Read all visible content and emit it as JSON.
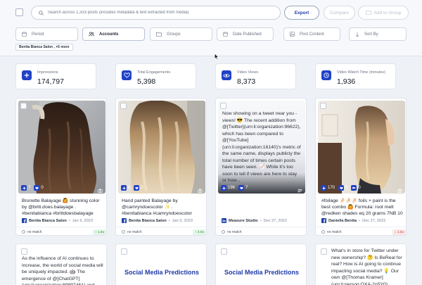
{
  "search": {
    "placeholder": "Search across 1,333 posts (includes metadata & text extracted from media)"
  },
  "actions": {
    "export": "Export",
    "compare": "Compare",
    "add_to_group": "Add to Group"
  },
  "filters": [
    {
      "label": "Period",
      "icon": "calendar-icon"
    },
    {
      "label": "Accounts",
      "icon": "people-icon",
      "active": true
    },
    {
      "label": "Groups",
      "icon": "folder-icon"
    },
    {
      "label": "Date Published",
      "icon": "calendar-icon"
    },
    {
      "label": "Post Content",
      "icon": "content-icon"
    },
    {
      "label": "Sort By",
      "icon": "sort-icon"
    }
  ],
  "active_chip": "Benita Bianca Salon , +6 more",
  "stats": [
    {
      "label": "Impressions",
      "value": "174,797",
      "icon": "plus-icon"
    },
    {
      "label": "Total Engagements",
      "value": "5,398",
      "icon": "heart-icon"
    },
    {
      "label": "Video Views",
      "value": "8,373",
      "icon": "eye-icon"
    },
    {
      "label": "Video Watch Time (minutes)",
      "value": "1,936",
      "icon": "clock-icon"
    }
  ],
  "posts": [
    {
      "impressions": "7",
      "likes": "0",
      "extra": null,
      "media_type": "camera-icon",
      "caption": "Brunette Balayage 🙆 stunning color by @britt.does.balayage . #benitabianca #brittdoesbalayage",
      "author": "Benita Bianca Salon",
      "date": "Jan 5, 2023",
      "match": "no match",
      "diff": "↑ 1.8x",
      "diff_dir": "up"
    },
    {
      "impressions": "6",
      "likes": "0",
      "extra": null,
      "media_type": "camera-icon",
      "caption": "Hand painted Balayage by @camryndoescolor ✨ . #benitabianca #camryndoescolor #balayage",
      "author": "Benita Bianca Salon",
      "date": "Jan 5, 2023",
      "match": "no match",
      "diff": "↑ 4.9x",
      "diff_dir": "up"
    },
    {
      "impressions": "196",
      "likes": "7",
      "extra": null,
      "media_type": "text-icon",
      "text_preview": "Now showing on a tweet near you - views! 😎 The recent addition from @[Twitter](urn:li:organization:96622), which has been compared to @[YouTube](urn:li:organization:16140)'s metric of the same name, displays publicly the total number of times certain posts have been seen. 📈 While it's too soon to tell if views are here to stay or how...",
      "caption": "",
      "author": "Measure Studio",
      "date": "Dec 27, 2022",
      "match": "no match",
      "diff": null,
      "diff_dir": null
    },
    {
      "impressions": "170",
      "likes": "6",
      "extra": "0",
      "media_type": "camera-icon",
      "caption": "#foilage 🤌🏻🤌🏻🤌🏻 foils + paint is the best combo 🙆 Formula: root melt @redken shades eq 20 grams 7NB 10 grams 6GI",
      "author": "Daniella Benita",
      "date": "Dec 27, 2022",
      "match": "no match",
      "diff": "↓ 1.6x",
      "diff_dir": "down"
    }
  ],
  "row2": [
    {
      "text": "As the influence of AI continues to increase, the world of social media will be uniquely impacted. 🤖 The emergence of @[ChatGPT](urn:li:organization:89897461) and",
      "title": null
    },
    {
      "text": null,
      "title": "Social Media Predictions"
    },
    {
      "text": null,
      "title": "Social Media Predictions"
    },
    {
      "text": "What's in store for Twitter under new ownership? 🤔 Is BeReal for real? How is AI going to continue impacting social media? 💡 Our own @[Thomas Kramer](urn:li:person:OXA-2n5Y0)",
      "title": null
    }
  ]
}
